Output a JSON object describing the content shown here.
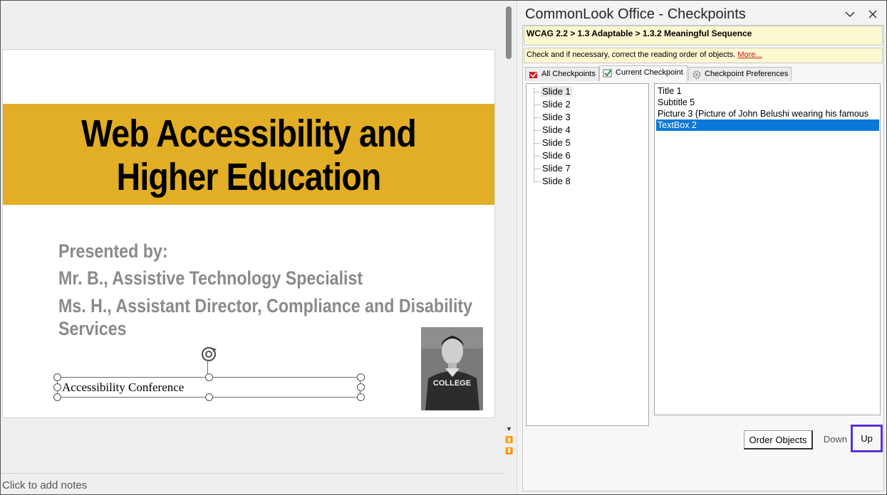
{
  "slide": {
    "title_line1": "Web Accessibility and",
    "title_line2": "Higher Education",
    "subtitle_lines": [
      "Presented by:",
      "Mr. B., Assistive Technology Specialist",
      "Ms. H., Assistant Director, Compliance and Disability",
      "Services"
    ],
    "textbox_text": "Accessibility Conference",
    "photo_text": "COLLEGE",
    "title_band_color": "#e1ae25"
  },
  "notes_placeholder": "Click to add notes",
  "pane": {
    "title": "CommonLook Office - Checkpoints",
    "breadcrumb": "WCAG 2.2 > 1.3 Adaptable > 1.3.2 Meaningful Sequence",
    "description": "Check and if necessary, correct the reading order of objects.",
    "more_link": "More...",
    "tabs": [
      {
        "label": "All Checkpoints",
        "icon": "checkpoints-icon"
      },
      {
        "label": "Current Checkpoint",
        "icon": "check-icon"
      },
      {
        "label": "Checkpoint Preferences",
        "icon": "gear-icon"
      }
    ],
    "active_tab": "Current Checkpoint",
    "slides": [
      "Slide 1",
      "Slide 2",
      "Slide 3",
      "Slide 4",
      "Slide 5",
      "Slide 6",
      "Slide 7",
      "Slide 8"
    ],
    "selected_slide": "Slide 1",
    "objects": [
      "Title 1",
      "Subtitle 5",
      "Picture 3 {Picture of John Belushi wearing his famous",
      "TextBox 2"
    ],
    "selected_object": "TextBox 2",
    "buttons": {
      "order_objects": "Order Objects",
      "down": "Down",
      "up": "Up"
    },
    "highlight_color": "#5b2fd8",
    "selection_color": "#0a78d7"
  }
}
